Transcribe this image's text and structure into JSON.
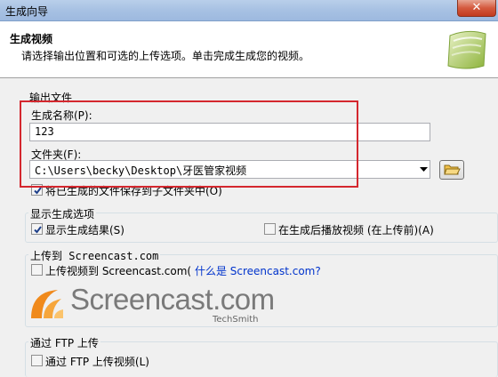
{
  "window": {
    "title": "生成向导",
    "close_glyph": "✕"
  },
  "header": {
    "title": "生成视频",
    "subtitle": "请选择输出位置和可选的上传选项。单击完成生成您的视频。"
  },
  "output_file": {
    "group_label": "输出文件",
    "name_label": "生成名称(P):",
    "name_value": "123",
    "folder_label": "文件夹(F):",
    "folder_value": "C:\\Users\\becky\\Desktop\\牙医管家视频",
    "organize_label": "将已生成的文件保存到子文件夹中(O)",
    "organize_checked": true
  },
  "display_options": {
    "group_label": "显示生成选项",
    "show_results_label": "显示生成结果(S)",
    "show_results_checked": true,
    "play_after_label": "在生成后播放视频 (在上传前)(A)",
    "play_after_checked": false
  },
  "screencast": {
    "group_label": "上传到 Screencast.com",
    "upload_label": "上传视频到 Screencast.com(",
    "what_is_link": "什么是 Screencast.com?",
    "logo_text": "Screencast.com",
    "logo_sub": "TechSmith",
    "upload_checked": false
  },
  "ftp": {
    "group_label": "通过 FTP 上传",
    "upload_label": "通过 FTP 上传视频(L)",
    "upload_checked": false
  },
  "colors": {
    "highlight": "#d4272e",
    "link": "#0033cc"
  },
  "icons": {
    "close": "close-icon",
    "folder": "folder-open-icon",
    "combo": "chevron-down-icon",
    "logo": "camtasia-logo-icon"
  }
}
